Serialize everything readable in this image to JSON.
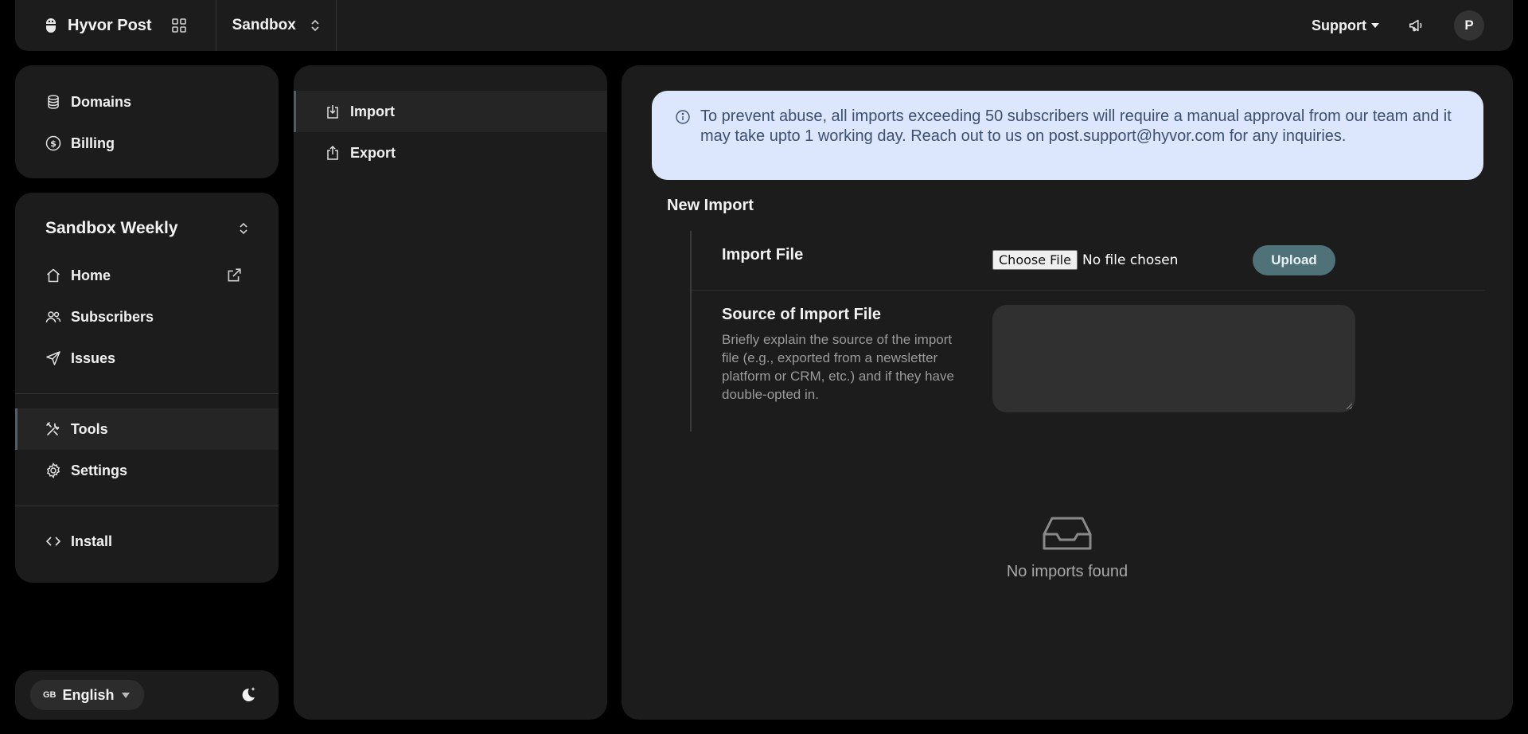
{
  "topbar": {
    "brand": "Hyvor Post",
    "project": "Sandbox",
    "support": "Support",
    "avatar_initial": "P"
  },
  "sidebar": {
    "top_items": [
      {
        "label": "Domains",
        "icon": "database-icon"
      },
      {
        "label": "Billing",
        "icon": "dollar-circle-icon"
      }
    ],
    "newsletter": "Sandbox Weekly",
    "items": [
      {
        "label": "Home",
        "icon": "home-icon"
      },
      {
        "label": "Subscribers",
        "icon": "people-icon"
      },
      {
        "label": "Issues",
        "icon": "send-icon"
      },
      {
        "label": "Tools",
        "icon": "tools-icon",
        "active": true
      },
      {
        "label": "Settings",
        "icon": "gear-icon"
      },
      {
        "label": "Install",
        "icon": "code-icon"
      }
    ],
    "language": {
      "flag": "GB",
      "label": "English"
    }
  },
  "tools_nav": [
    {
      "label": "Import",
      "icon": "download-icon",
      "active": true
    },
    {
      "label": "Export",
      "icon": "upload-icon"
    }
  ],
  "main": {
    "alert": "To prevent abuse, all imports exceeding 50 subscribers will require a manual approval from our team and it may take upto 1 working day. Reach out to us on post.support@hyvor.com for any inquiries.",
    "section_title": "New Import",
    "import_file_label": "Import File",
    "choose_file": "Choose File",
    "no_file": "No file chosen",
    "upload": "Upload",
    "source_label": "Source of Import File",
    "source_desc": "Briefly explain the source of the import file (e.g., exported from a newsletter platform or CRM, etc.) and if they have double-opted in.",
    "empty_text": "No imports found"
  },
  "colors": {
    "background": "#000000",
    "panel": "#1c1c1c",
    "alert_bg": "#dce6fd",
    "alert_text": "#3d5072",
    "accent": "#4e7278"
  }
}
